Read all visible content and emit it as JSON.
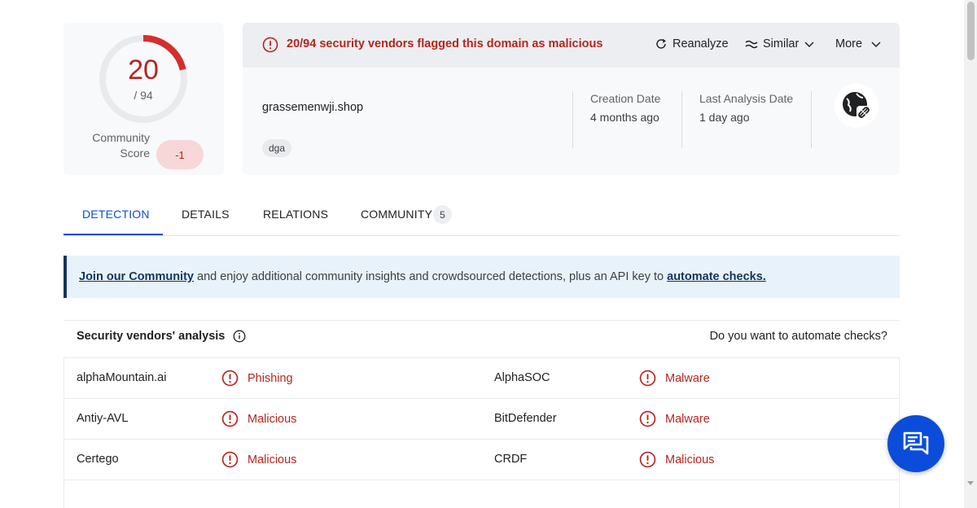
{
  "score": {
    "detections": "20",
    "total": "/ 94",
    "ratio": 0.2128,
    "community_label": "Community Score",
    "community_value": "-1"
  },
  "alert": {
    "text": "20/94 security vendors flagged this domain as malicious",
    "icon": "alert-circle-icon"
  },
  "actions": {
    "reanalyze": "Reanalyze",
    "similar": "Similar",
    "more": "More"
  },
  "domain": {
    "name": "grassemenwji.shop",
    "tag": "dga"
  },
  "meta": {
    "creation_label": "Creation Date",
    "creation_value": "4 months ago",
    "analysis_label": "Last Analysis Date",
    "analysis_value": "1 day ago"
  },
  "tabs": [
    {
      "label": "DETECTION",
      "active": true
    },
    {
      "label": "DETAILS",
      "active": false
    },
    {
      "label": "RELATIONS",
      "active": false
    },
    {
      "label": "COMMUNITY",
      "active": false,
      "count": "5"
    }
  ],
  "banner": {
    "link1": "Join our Community",
    "middle": " and enjoy additional community insights and crowdsourced detections, plus an API key to ",
    "link2": "automate checks."
  },
  "analysis": {
    "title": "Security vendors' analysis",
    "automate": "Do you want to automate checks?",
    "rows": [
      {
        "vendor1": "alphaMountain.ai",
        "verdict1": "Phishing",
        "vendor2": "AlphaSOC",
        "verdict2": "Malware"
      },
      {
        "vendor1": "Antiy-AVL",
        "verdict1": "Malicious",
        "vendor2": "BitDefender",
        "verdict2": "Malware"
      },
      {
        "vendor1": "Certego",
        "verdict1": "Malicious",
        "vendor2": "CRDF",
        "verdict2": "Malicious"
      }
    ]
  },
  "colors": {
    "malicious": "#b3261e",
    "accent": "#0b4dda",
    "banner_link": "#16325c"
  }
}
